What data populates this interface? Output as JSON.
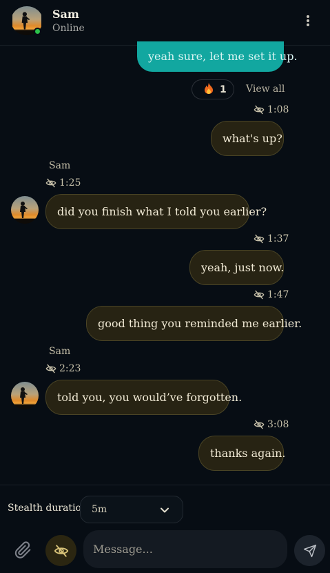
{
  "header": {
    "name": "Sam",
    "status": "Online"
  },
  "messages": [
    {
      "type": "out-teal",
      "text": "yeah sure, let me set it up."
    },
    {
      "type": "reaction",
      "emoji": "fire",
      "count": "1",
      "view_all": "View all"
    },
    {
      "type": "out",
      "time": "1:08",
      "text": "what's up?"
    },
    {
      "type": "in",
      "sender": "Sam",
      "time": "1:25",
      "text": "did you finish what I told you earlier?"
    },
    {
      "type": "out",
      "time": "1:37",
      "text": "yeah, just now."
    },
    {
      "type": "out",
      "time": "1:47",
      "text": "good thing you reminded me earlier."
    },
    {
      "type": "in",
      "sender": "Sam",
      "time": "2:23",
      "text": "told you, you would’ve forgotten."
    },
    {
      "type": "out",
      "time": "3:08",
      "text": "thanks again."
    }
  ],
  "footer": {
    "stealth_label": "Stealth duration",
    "stealth_value": "5m",
    "message_placeholder": "Message..."
  },
  "icons": {
    "menu": "kebab-icon",
    "hidden": "eye-off-icon",
    "attach": "paperclip-icon",
    "send": "send-icon",
    "dropdown": "chevron-down-icon"
  },
  "colors": {
    "background": "#070d14",
    "bubble": "#272313",
    "bubble_border": "#4a4425",
    "teal_bubble": "#12a7a0",
    "online": "#2bc24a"
  }
}
